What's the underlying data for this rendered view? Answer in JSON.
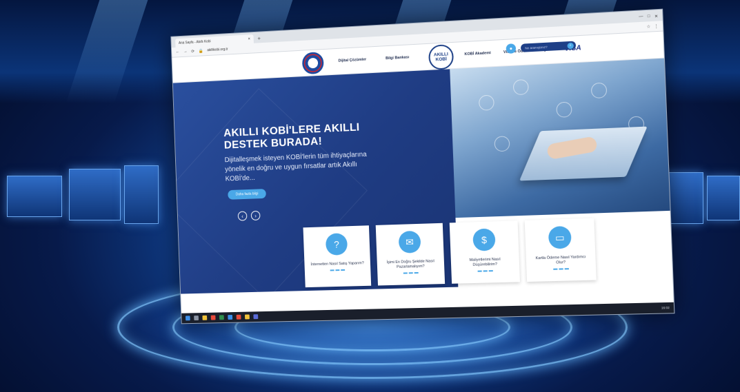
{
  "browser": {
    "tab_title": "Ana Sayfa - Akıllı Kobi",
    "tab_close": "×",
    "new_tab": "+",
    "url": "akillikobi.org.tr"
  },
  "header": {
    "nav_dijital": "Dijital Çözümler",
    "nav_bilgi": "Bilgi Bankası",
    "logo_line1": "AKILLI",
    "logo_line2": "KOBİ",
    "nav_akademi": "KOBİ Akademi",
    "nav_visa_world": "Visa ve Ödemeler Dünyası",
    "visa_logo": "VISA",
    "search_placeholder": "Ne aramıştınız?"
  },
  "hero": {
    "title_line1": "AKILLI KOBİ'LERE AKILLI",
    "title_line2": "DESTEK BURADA!",
    "subtitle": "Dijitalleşmek isteyen KOBİ'lerin tüm ihtiyaçlarına yönelik en doğru ve uygun fırsatlar artık Akıllı KOBİ'de...",
    "button_label": "Daha fazla bilgi",
    "prev_arrow": "‹",
    "next_arrow": "›"
  },
  "cards": [
    {
      "text": "İnternetten Nasıl Satış Yaparım?",
      "icon": "person-question-icon"
    },
    {
      "text": "İşimi En Doğru Şekilde Nasıl Pazarlamalıyım?",
      "icon": "chat-bubbles-icon"
    },
    {
      "text": "Maliyetlerimi Nasıl Düşürebilirim?",
      "icon": "coins-hand-icon"
    },
    {
      "text": "Kartla Ödeme Nasıl Yardımcı Olur?",
      "icon": "card-hand-icon"
    }
  ],
  "taskbar": {
    "clock": "16:02"
  },
  "colors": {
    "hero_blue": "#1f3c83",
    "accent_blue": "#4aa8e8",
    "navy": "#1c3f86"
  }
}
